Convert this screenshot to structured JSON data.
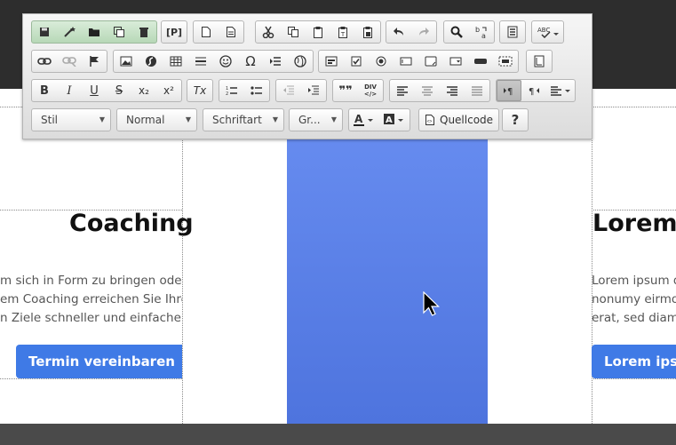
{
  "toolbar": {
    "style_combo": "Stil",
    "format_combo": "Normal",
    "font_combo": "Schriftart",
    "size_combo": "Gr...",
    "source_label": "Quellcode",
    "help_label": "?",
    "bold_label": "B",
    "italic_label": "I",
    "underline_label": "U",
    "strike_label": "S",
    "subscript_label": "x₂",
    "superscript_label": "x²",
    "clearformat_label": "Tx",
    "omega_label": "Ω",
    "template_label": "[P]",
    "div_label": "DIV",
    "blockquote_label": "❞❞"
  },
  "cards": {
    "left": {
      "title": "Coaching",
      "lines": [
        "m sich in Form zu bringen oder",
        "em Coaching erreichen Sie Ihre",
        "n Ziele schneller und einfacher."
      ],
      "button": "Termin vereinbaren"
    },
    "right": {
      "title": "Lorem",
      "lines": [
        "Lorem ipsum d",
        "nonumy eirmo",
        "erat, sed diam"
      ],
      "button": "Lorem ips"
    }
  },
  "colors": {
    "accent_button": "#3f7ae6",
    "stripe_top": "#6a8ff2",
    "stripe_bottom": "#4e74de",
    "topbar": "#2d2d2d"
  }
}
